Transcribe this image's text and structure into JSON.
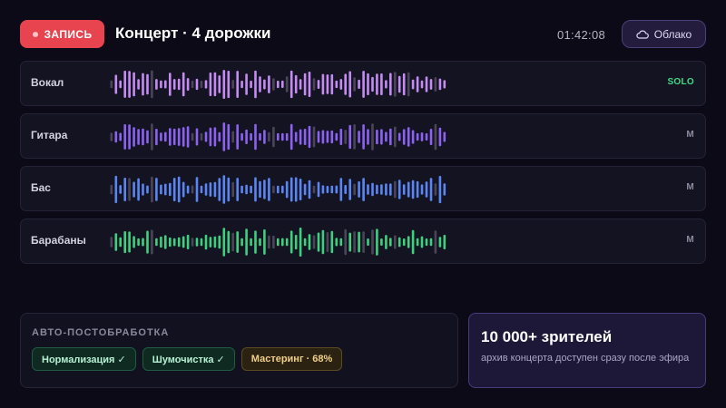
{
  "header": {
    "record_label": "ЗАПИСЬ",
    "title": "Концерт · 4 дорожки",
    "timecode": "01:42:08",
    "cloud_label": "Облако"
  },
  "tracks": [
    {
      "name": "Вокал",
      "control": "SOLO",
      "color": "#c48cf2"
    },
    {
      "name": "Гитара",
      "control": "M",
      "color": "#8b63f0"
    },
    {
      "name": "Бас",
      "control": "M",
      "color": "#5b86f2"
    },
    {
      "name": "Барабаны",
      "control": "M",
      "color": "#3fd07f"
    }
  ],
  "post_processing": {
    "title": "АВТО-ПОСТОБРАБОТКА",
    "steps": [
      {
        "label": "Нормализация ✓",
        "status": "done"
      },
      {
        "label": "Шумочистка ✓",
        "status": "done"
      },
      {
        "label": "Мастеринг · 68%",
        "status": "in-progress",
        "progress_percent": 68
      }
    ]
  },
  "promo": {
    "title": "10 000+ зрителей",
    "text": "архив концерта доступен сразу после эфира"
  },
  "colors": {
    "record": "#e8444f",
    "solo": "#3ddc84",
    "accent": "#473c7c",
    "inactive_bar": "#4a4658"
  },
  "icons": {
    "record": "record-dot-icon",
    "cloud": "cloud-icon"
  }
}
